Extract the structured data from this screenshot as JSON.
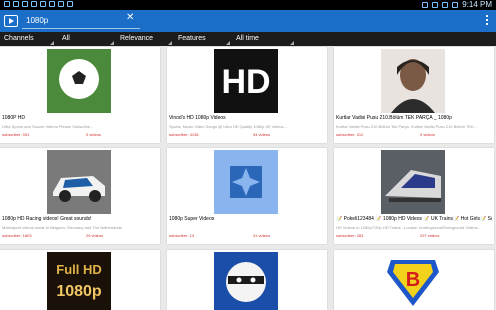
{
  "status": {
    "time": "9:14 PM",
    "left_icons": [
      "signal-icon",
      "photo-icon",
      "usb-icon",
      "mail-icon",
      "mail-icon",
      "gallery-icon",
      "mail-icon",
      "ui-icon"
    ],
    "right_icons": [
      "sound-icon",
      "wifi-icon",
      "signal-icon",
      "battery-icon"
    ]
  },
  "appbar": {
    "query": "1080p",
    "clear": "✕"
  },
  "filters": {
    "channels": "Channels",
    "all": "All",
    "relevance": "Relevance",
    "features": "Features",
    "alltime": "All time"
  },
  "cards": [
    {
      "title": "1080P HD",
      "desc": "Ultra Sports and Soccer Videos Please Subscribe...",
      "subs": "subscriber: 931",
      "videos": "0 videos",
      "thumb": "soccer"
    },
    {
      "title": "Vinod's HD 1080p Videos",
      "desc": "Sports, Music Video Songs @ Ultra HD Quality 1080p 4K Videos...",
      "subs": "subscriber: 4136",
      "videos": "94 videos",
      "thumb": "hd"
    },
    {
      "title": "Kurtlar Vadisi Pusu 210.Bölüm TEK PARÇA _ 1080p",
      "desc": "Kurtlar Vadisi Pusu 210.Bölüm Tek Parça, Kurtlar Vadisi Pusu 210 Bölüm TEK...",
      "subs": "subscriber: 312",
      "videos": "0 videos",
      "thumb": "man"
    },
    {
      "title": "1080p HD Racing videos! Great sounds!",
      "desc": "Motorsport videos made in Belgium, Germany and The Netherlands",
      "subs": "subscriber: 1803",
      "videos": "29 videos",
      "thumb": "car"
    },
    {
      "title": "1080p Super Videos",
      "desc": "",
      "subs": "subscriber: 13",
      "videos": "31 videos",
      "thumb": "default"
    },
    {
      "title": "📝 Pokeli123484 📝 1080p HD Videos 📝 UK Trains📝 Hot Girls📝 Subscribe",
      "desc": "HD Videos In 1080p/720p HD Trains - London Underground/Overground Videos...",
      "subs": "subscriber: 283",
      "videos": "297 videos",
      "thumb": "train"
    },
    {
      "title": "",
      "desc": "",
      "subs": "",
      "videos": "",
      "thumb": "fullhd"
    },
    {
      "title": "",
      "desc": "",
      "subs": "",
      "videos": "",
      "thumb": "ninja"
    },
    {
      "title": "",
      "desc": "",
      "subs": "",
      "videos": "",
      "thumb": "bsuper"
    }
  ],
  "thumb_text": {
    "hd": "HD",
    "fullhd_top": "Full HD",
    "fullhd_bottom": "1080p",
    "bsuper": "B"
  },
  "colors": {
    "appbar": "#1a6ec7",
    "filterbar": "#1c1c1c",
    "accent_red": "#d03030"
  }
}
